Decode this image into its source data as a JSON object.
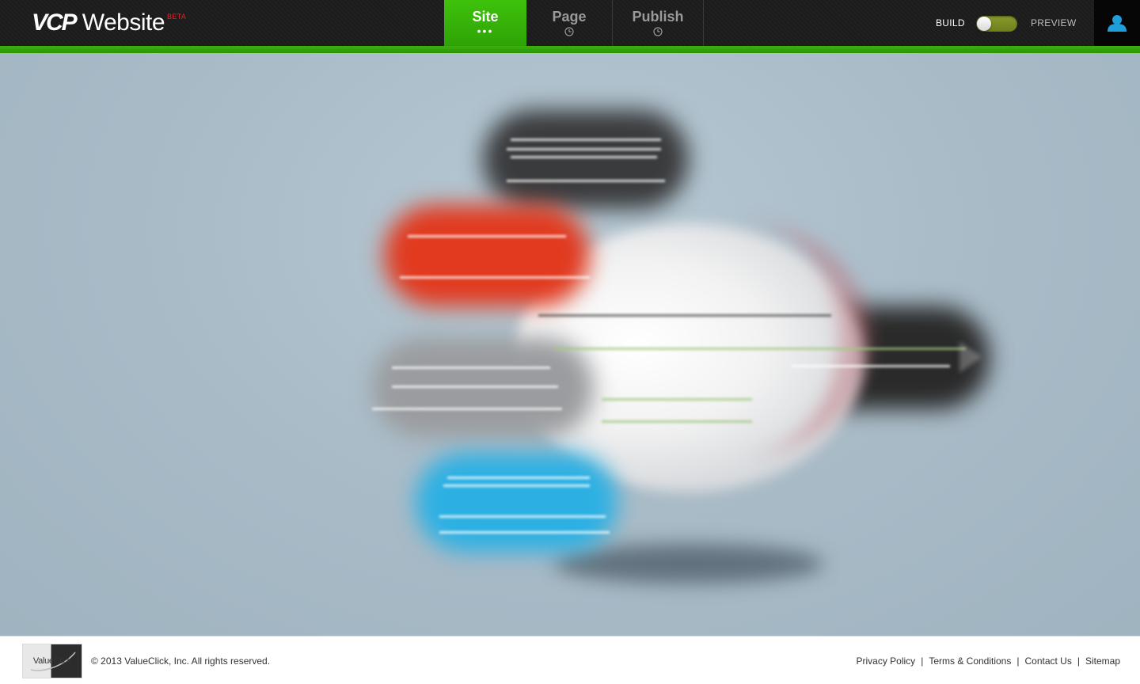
{
  "header": {
    "logo_primary": "VCP",
    "logo_secondary": "Website",
    "logo_badge": "BETA",
    "tabs": [
      {
        "label": "Site",
        "indicator": "•••",
        "active": true
      },
      {
        "label": "Page",
        "indicator": "clock-icon",
        "active": false
      },
      {
        "label": "Publish",
        "indicator": "clock-icon",
        "active": false
      }
    ],
    "mode_toggle": {
      "left_label": "BUILD",
      "right_label": "PREVIEW"
    },
    "user_icon": "user-icon"
  },
  "footer": {
    "logo_text": "ValueClick",
    "copyright": "© 2013 ValueClick, Inc. All rights reserved.",
    "links": [
      {
        "label": "Privacy Policy"
      },
      {
        "label": "Terms & Conditions"
      },
      {
        "label": "Contact Us"
      },
      {
        "label": "Sitemap"
      }
    ]
  },
  "colors": {
    "accent_green": "#3ec20c",
    "topbar": "#1c1c1c",
    "stage_bg": "#a9bac6",
    "toggle_track": "#7e8d25",
    "user_icon": "#1e9fdc",
    "beta_red": "#e4242a"
  }
}
